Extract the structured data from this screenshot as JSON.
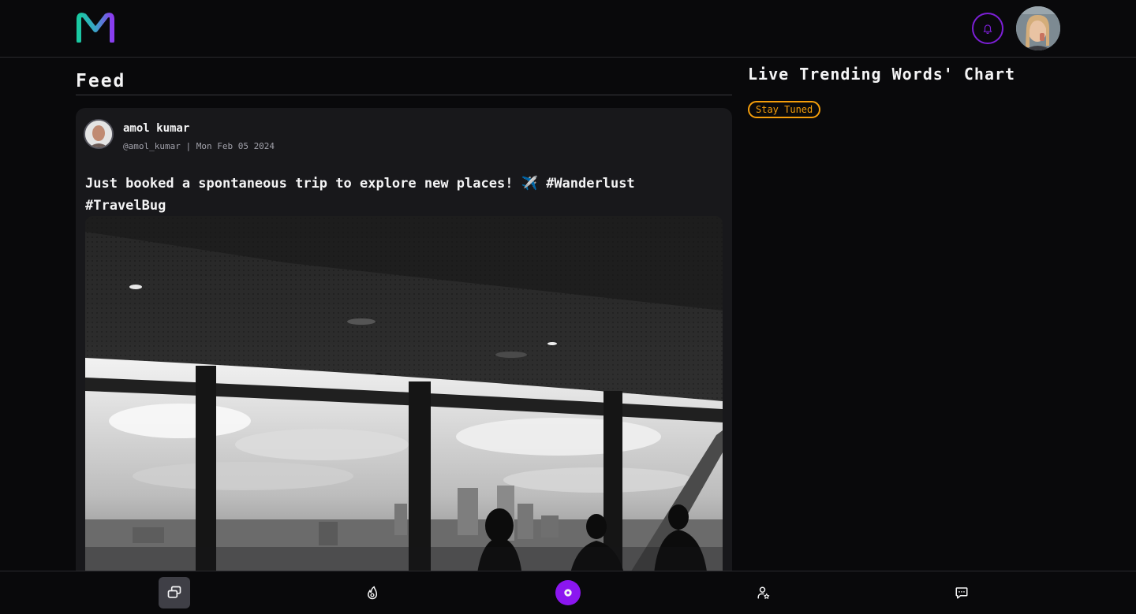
{
  "header": {
    "logo_icon": "m-logo-icon",
    "notification_icon": "bell-icon",
    "accent_color": "#7c1fd6"
  },
  "feed": {
    "title": "Feed",
    "posts": [
      {
        "author_name": "amol kumar",
        "meta": "@amol_kumar | Mon Feb 05 2024",
        "text": "Just booked a spontaneous trip to explore new places! ✈️ #Wanderlust #TravelBug"
      }
    ]
  },
  "trending": {
    "title": "Live Trending Words' Chart",
    "badge": "Stay Tuned",
    "badge_color": "#f59e0b"
  },
  "bottom_nav": {
    "items": [
      {
        "icon": "gallery-icon",
        "active": true
      },
      {
        "icon": "fire-icon",
        "active": false
      },
      {
        "icon": "create-post-icon",
        "active": false
      },
      {
        "icon": "user-star-icon",
        "active": false
      },
      {
        "icon": "chat-icon",
        "active": false
      }
    ],
    "center_color": "#8b16f0"
  }
}
